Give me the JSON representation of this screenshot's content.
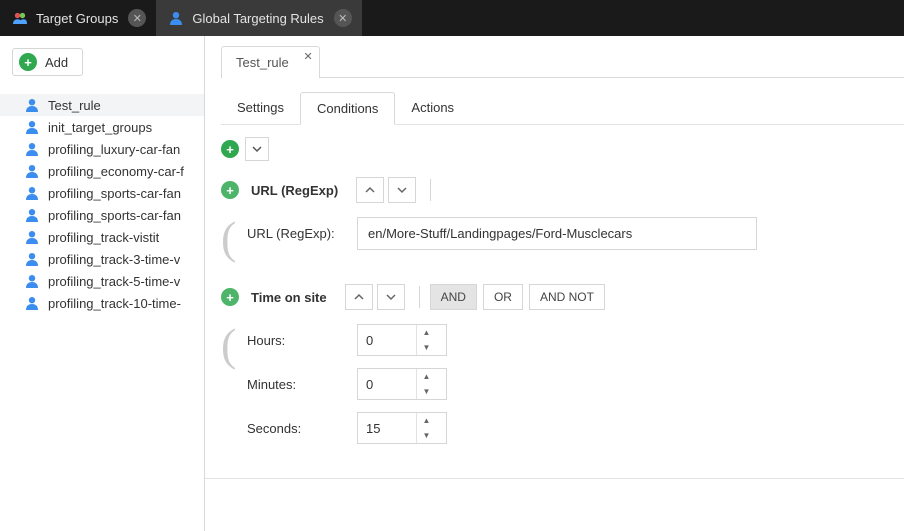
{
  "tabs": {
    "items": [
      {
        "label": "Target Groups",
        "icon": "group"
      },
      {
        "label": "Global Targeting Rules",
        "icon": "user"
      }
    ],
    "active": 1
  },
  "sidebar": {
    "add_label": "Add",
    "items": [
      {
        "label": "Test_rule"
      },
      {
        "label": "init_target_groups"
      },
      {
        "label": "profiling_luxury-car-fan"
      },
      {
        "label": "profiling_economy-car-f"
      },
      {
        "label": "profiling_sports-car-fan"
      },
      {
        "label": "profiling_sports-car-fan"
      },
      {
        "label": "profiling_track-vistit"
      },
      {
        "label": "profiling_track-3-time-v"
      },
      {
        "label": "profiling_track-5-time-v"
      },
      {
        "label": "profiling_track-10-time-"
      }
    ],
    "active": 0
  },
  "doc_tab": {
    "label": "Test_rule"
  },
  "sub_tabs": {
    "items": [
      {
        "label": "Settings"
      },
      {
        "label": "Conditions"
      },
      {
        "label": "Actions"
      }
    ],
    "active": 1
  },
  "conditions": [
    {
      "title": "URL (RegExp)",
      "operators": [],
      "fields": [
        {
          "label": "URL (RegExp):",
          "type": "text",
          "value": "en/More-Stuff/Landingpages/Ford-Musclecars"
        }
      ]
    },
    {
      "title": "Time on site",
      "operators": [
        "AND",
        "OR",
        "AND NOT"
      ],
      "active_operator": 0,
      "fields": [
        {
          "label": "Hours:",
          "type": "number",
          "value": "0"
        },
        {
          "label": "Minutes:",
          "type": "number",
          "value": "0"
        },
        {
          "label": "Seconds:",
          "type": "number",
          "value": "15"
        }
      ]
    }
  ]
}
